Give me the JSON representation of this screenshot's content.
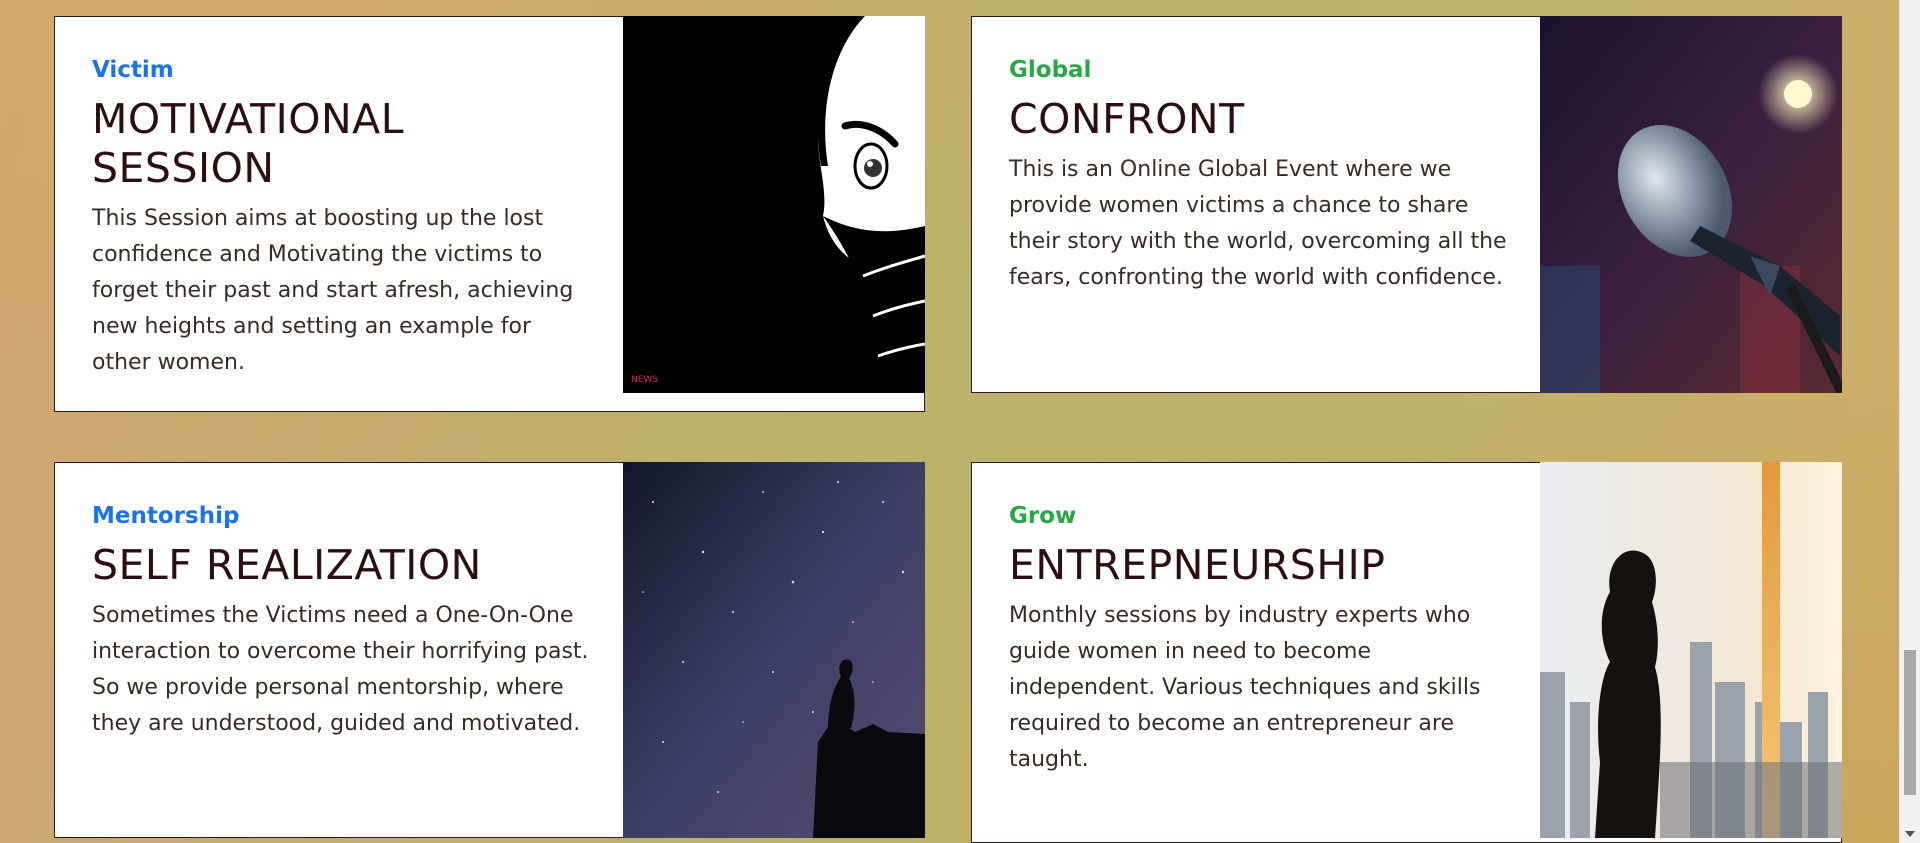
{
  "cards": [
    {
      "category": "Victim",
      "category_color": "#1a73e8",
      "title": "MOTIVATIONAL SESSION",
      "description": "This Session aims at boosting up the lost confidence and Motivating the victims to forget their past and start afresh, achieving new heights and setting an example for other women.",
      "image_icon": "masked-woman-illustration",
      "watermark": "NEWS"
    },
    {
      "category": "Global",
      "category_color": "#28a745",
      "title": "CONFRONT",
      "description": "This is an Online Global Event where we provide women victims a chance to share their story with the world, overcoming all the fears, confronting the world with confidence.",
      "image_icon": "microphone-photo"
    },
    {
      "category": "Mentorship",
      "category_color": "#1a73e8",
      "title": "SELF REALIZATION",
      "description": "Sometimes the Victims need a One-On-One interaction to overcome their horrifying past. So we provide personal mentorship, where they are understood, guided and motivated.",
      "image_icon": "night-sky-silhouette-photo"
    },
    {
      "category": "Grow",
      "category_color": "#28a745",
      "title": "ENTREPNEURSHIP",
      "description": "Monthly sessions by industry experts who guide women in need to become independent. Various techniques and skills required to become an entrepreneur are taught.",
      "image_icon": "businesswoman-city-window-photo"
    }
  ]
}
